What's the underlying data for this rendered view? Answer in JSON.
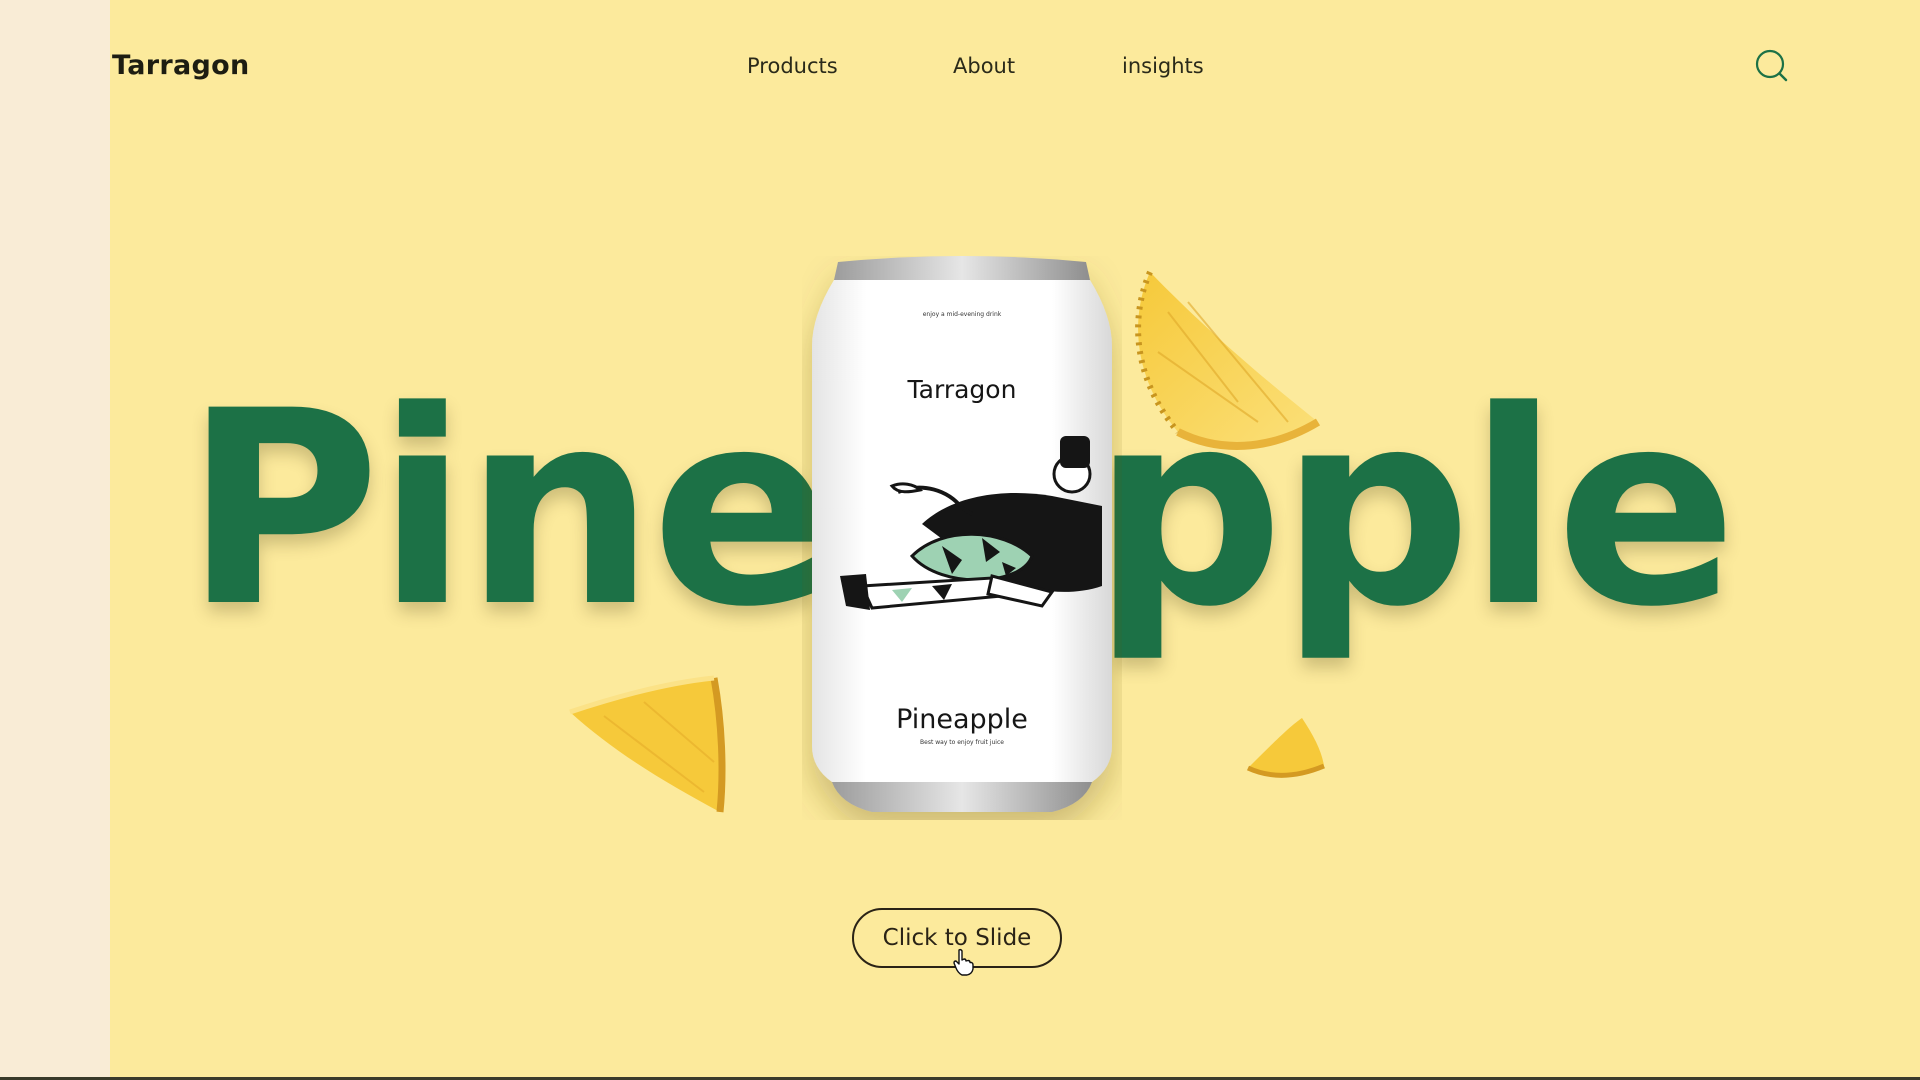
{
  "header": {
    "brand": "Tarragon",
    "nav": [
      "Products",
      "About",
      "insights"
    ]
  },
  "hero": {
    "word_left": "Pine",
    "word_right": "pple",
    "cta_label": "Click to Slide"
  },
  "can": {
    "tagline_top": "enjoy a mid-evening drink",
    "brand": "Tarragon",
    "flavor": "Pineapple",
    "subtitle": "Best way to enjoy fruit juice"
  },
  "icons": {
    "search": "search-icon"
  },
  "colors": {
    "background": "#fcea9c",
    "accent_green": "#1c7146",
    "text_dark": "#1d1d12",
    "left_strip": "#f9ecd6"
  }
}
